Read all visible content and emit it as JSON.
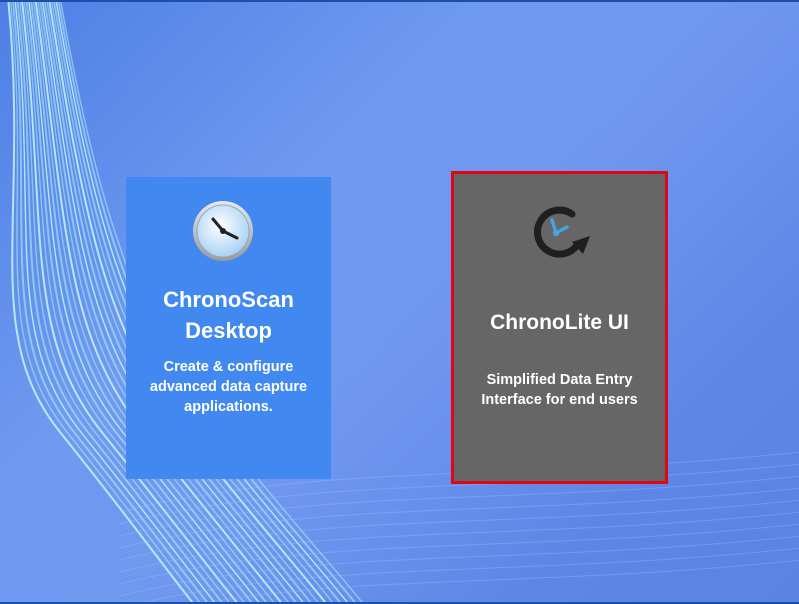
{
  "tiles": [
    {
      "title": "ChronoScan Desktop",
      "description": "Create & configure advanced data capture applications.",
      "icon": "clock-icon",
      "color": "#4189f0",
      "selected": false
    },
    {
      "title": "ChronoLite UI",
      "description": "Simplified Data Entry Interface for end users",
      "icon": "clock-refresh-icon",
      "color": "#666666",
      "selected": true,
      "selection_color": "#e20612"
    }
  ]
}
